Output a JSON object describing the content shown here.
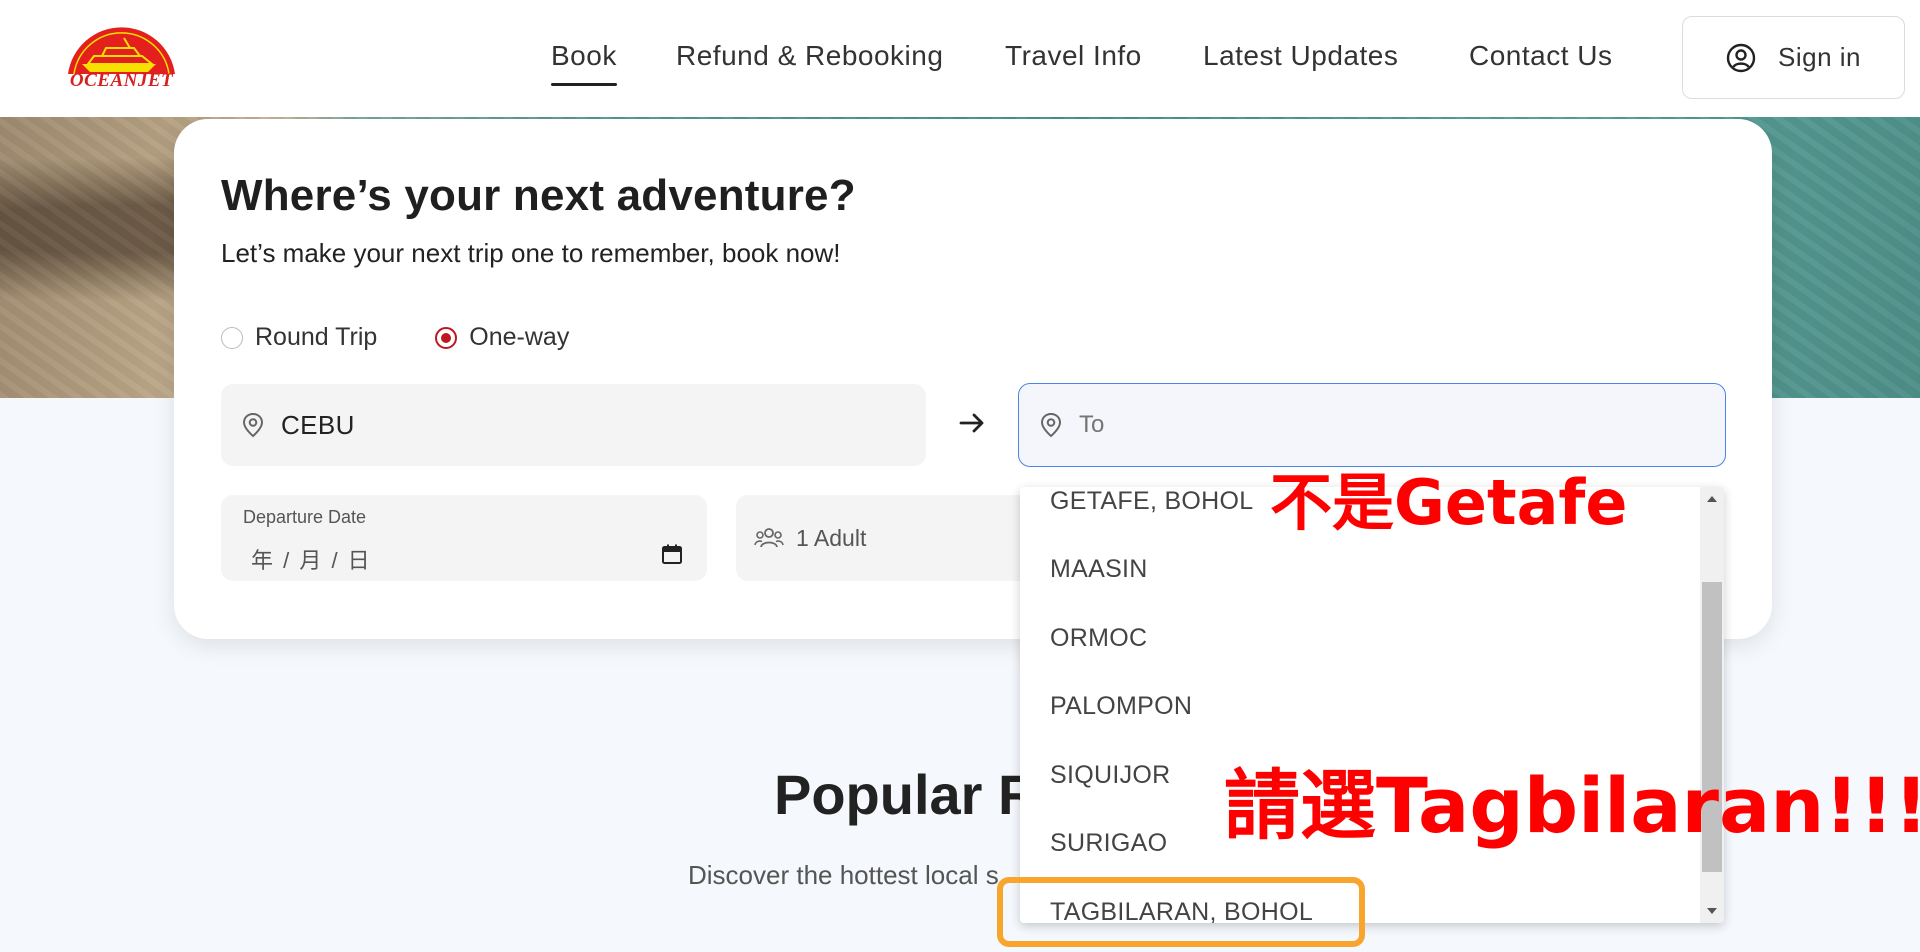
{
  "header": {
    "logo_text": "OCEANJET",
    "nav": [
      {
        "label": "Book",
        "active": true
      },
      {
        "label": "Refund & Rebooking",
        "active": false
      },
      {
        "label": "Travel Info",
        "active": false
      },
      {
        "label": "Latest Updates",
        "active": false
      },
      {
        "label": "Contact Us",
        "active": false
      }
    ],
    "signin_label": "Sign in"
  },
  "booking": {
    "title": "Where’s your next adventure?",
    "subtitle": "Let’s make your next trip one to remember, book now!",
    "trip_types": [
      {
        "label": "Round Trip",
        "selected": false
      },
      {
        "label": "One-way",
        "selected": true
      }
    ],
    "from_value": "CEBU",
    "to_placeholder": "To",
    "departure_label": "Departure Date",
    "departure_value": "年 / 月 / 日",
    "passengers_value": "1 Adult"
  },
  "dropdown": {
    "items": [
      "GETAFE, BOHOL",
      "MAASIN",
      "ORMOC",
      "PALOMPON",
      "SIQUIJOR",
      "SURIGAO",
      "TAGBILARAN, BOHOL"
    ]
  },
  "popular": {
    "title": "Popular R",
    "subtitle": "Discover the hottest local s"
  },
  "annotations": {
    "note_1": "不是Getafe",
    "note_2": "請選Tagbilaran!!!"
  },
  "colors": {
    "brand_red": "#c0171c",
    "focus_blue": "#4a84e6",
    "annotation_red": "#ff0000",
    "highlight_orange": "#f7a52c"
  }
}
